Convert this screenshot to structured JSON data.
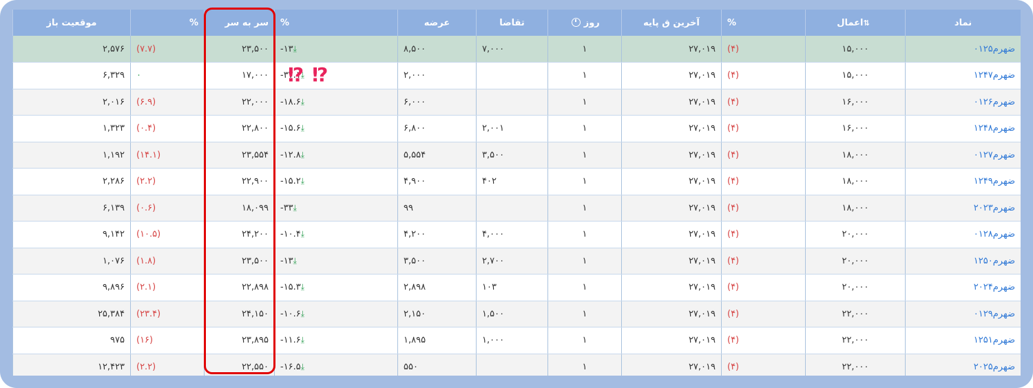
{
  "header": {
    "symbol": "نماد",
    "exercise": "اعمال",
    "exercise_sort_icon": "sort-icon",
    "pct": "%",
    "last_base": "آخرین ق پایه",
    "days": "روز",
    "days_icon": "clock-icon",
    "demand": "تقاضا",
    "supply": "عرضه",
    "pct2": "%",
    "breakeven": "سر به سر",
    "pct3": "%",
    "open_position": "موقعیت باز"
  },
  "annotation": {
    "marks": "⁉ ⁉"
  },
  "rows": [
    {
      "symbol": "ضهرم۰۱۲۵",
      "exercise": "۱۵,۰۰۰",
      "pct": "(۴)",
      "last": "۲۷,۰۱۹",
      "days": "۱",
      "demand": "۷,۰۰۰",
      "supply": "۸,۵۰۰",
      "pct2": "-۱۳",
      "breakeven": "۲۳,۵۰۰",
      "pct3": "(۷.۷)",
      "pos": "۲,۵۷۶"
    },
    {
      "symbol": "ضهرم۱۲۴۷",
      "exercise": "۱۵,۰۰۰",
      "pct": "(۴)",
      "last": "۲۷,۰۱۹",
      "days": "۱",
      "demand": "",
      "supply": "۲,۰۰۰",
      "pct2": "-۳۷.۱",
      "breakeven": "۱۷,۰۰۰",
      "pct3": "۰",
      "pos": "۶,۳۲۹"
    },
    {
      "symbol": "ضهرم۰۱۲۶",
      "exercise": "۱۶,۰۰۰",
      "pct": "(۴)",
      "last": "۲۷,۰۱۹",
      "days": "۱",
      "demand": "",
      "supply": "۶,۰۰۰",
      "pct2": "-۱۸.۶",
      "breakeven": "۲۲,۰۰۰",
      "pct3": "(۶.۹)",
      "pos": "۲,۰۱۶"
    },
    {
      "symbol": "ضهرم۱۲۴۸",
      "exercise": "۱۶,۰۰۰",
      "pct": "(۴)",
      "last": "۲۷,۰۱۹",
      "days": "۱",
      "demand": "۲,۰۰۱",
      "supply": "۶,۸۰۰",
      "pct2": "-۱۵.۶",
      "breakeven": "۲۲,۸۰۰",
      "pct3": "(۰.۴)",
      "pos": "۱,۳۲۳"
    },
    {
      "symbol": "ضهرم۰۱۲۷",
      "exercise": "۱۸,۰۰۰",
      "pct": "(۴)",
      "last": "۲۷,۰۱۹",
      "days": "۱",
      "demand": "۳,۵۰۰",
      "supply": "۵,۵۵۴",
      "pct2": "-۱۲.۸",
      "breakeven": "۲۳,۵۵۴",
      "pct3": "(۱۴.۱)",
      "pos": "۱,۱۹۲"
    },
    {
      "symbol": "ضهرم۱۲۴۹",
      "exercise": "۱۸,۰۰۰",
      "pct": "(۴)",
      "last": "۲۷,۰۱۹",
      "days": "۱",
      "demand": "۴۰۲",
      "supply": "۴,۹۰۰",
      "pct2": "-۱۵.۲",
      "breakeven": "۲۲,۹۰۰",
      "pct3": "(۲.۲)",
      "pos": "۲,۲۸۶"
    },
    {
      "symbol": "ضهرم۲۰۲۳",
      "exercise": "۱۸,۰۰۰",
      "pct": "(۴)",
      "last": "۲۷,۰۱۹",
      "days": "۱",
      "demand": "",
      "supply": "۹۹",
      "pct2": "-۳۳",
      "breakeven": "۱۸,۰۹۹",
      "pct3": "(۰.۶)",
      "pos": "۶,۱۳۹"
    },
    {
      "symbol": "ضهرم۰۱۲۸",
      "exercise": "۲۰,۰۰۰",
      "pct": "(۴)",
      "last": "۲۷,۰۱۹",
      "days": "۱",
      "demand": "۴,۰۰۰",
      "supply": "۴,۲۰۰",
      "pct2": "-۱۰.۴",
      "breakeven": "۲۴,۲۰۰",
      "pct3": "(۱۰.۵)",
      "pos": "۹,۱۴۲"
    },
    {
      "symbol": "ضهرم۱۲۵۰",
      "exercise": "۲۰,۰۰۰",
      "pct": "(۴)",
      "last": "۲۷,۰۱۹",
      "days": "۱",
      "demand": "۲,۷۰۰",
      "supply": "۳,۵۰۰",
      "pct2": "-۱۳",
      "breakeven": "۲۳,۵۰۰",
      "pct3": "(۱.۸)",
      "pos": "۱,۰۷۶"
    },
    {
      "symbol": "ضهرم۲۰۲۴",
      "exercise": "۲۰,۰۰۰",
      "pct": "(۴)",
      "last": "۲۷,۰۱۹",
      "days": "۱",
      "demand": "۱۰۳",
      "supply": "۲,۸۹۸",
      "pct2": "-۱۵.۳",
      "breakeven": "۲۲,۸۹۸",
      "pct3": "(۲.۱)",
      "pos": "۹,۸۹۶"
    },
    {
      "symbol": "ضهرم۰۱۲۹",
      "exercise": "۲۲,۰۰۰",
      "pct": "(۴)",
      "last": "۲۷,۰۱۹",
      "days": "۱",
      "demand": "۱,۵۰۰",
      "supply": "۲,۱۵۰",
      "pct2": "-۱۰.۶",
      "breakeven": "۲۴,۱۵۰",
      "pct3": "(۲۳.۴)",
      "pos": "۲۵,۳۸۴"
    },
    {
      "symbol": "ضهرم۱۲۵۱",
      "exercise": "۲۲,۰۰۰",
      "pct": "(۴)",
      "last": "۲۷,۰۱۹",
      "days": "۱",
      "demand": "۱,۰۰۰",
      "supply": "۱,۸۹۵",
      "pct2": "-۱۱.۶",
      "breakeven": "۲۳,۸۹۵",
      "pct3": "(۱۶)",
      "pos": "۹۷۵"
    },
    {
      "symbol": "ضهرم۲۰۲۵",
      "exercise": "۲۲,۰۰۰",
      "pct": "(۴)",
      "last": "۲۷,۰۱۹",
      "days": "۱",
      "demand": "",
      "supply": "۵۵۰",
      "pct2": "-۱۶.۵",
      "breakeven": "۲۲,۵۵۰",
      "pct3": "(۲.۲)",
      "pos": "۱۲,۴۲۳"
    }
  ],
  "colors": {
    "header_bg": "#8fb0e0",
    "frame": "#a3bce2",
    "highlight_row": "#c8ddd2",
    "link": "#2f78d6",
    "negative": "#d64545",
    "focus_box": "#e00000"
  }
}
